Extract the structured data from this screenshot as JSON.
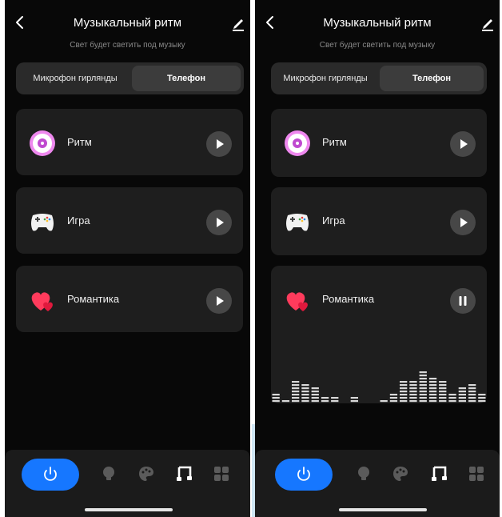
{
  "colors": {
    "accent": "#1677ff",
    "background": "#080808",
    "card": "#1e1e1e",
    "muted": "#8a8a8a"
  },
  "screens": [
    {
      "header": {
        "title": "Музыкальный ритм",
        "subtitle": "Свет будет светить под музыку",
        "back_icon": "chevron-left-icon",
        "edit_icon": "pencil-icon"
      },
      "segment": {
        "options": [
          "Микрофон гирлянды",
          "Телефон"
        ],
        "selected": "Телефон"
      },
      "cards": [
        {
          "label": "Ритм",
          "icon": "disc-icon",
          "state": "play-icon"
        },
        {
          "label": "Игра",
          "icon": "gamepad-icon",
          "state": "play-icon"
        },
        {
          "label": "Романтика",
          "icon": "hearts-icon",
          "state": "play-icon"
        }
      ],
      "tabbar": {
        "items": [
          "power-icon",
          "bulb-icon",
          "palette-icon",
          "music-icon",
          "grid-icon"
        ],
        "active": "music-icon"
      }
    },
    {
      "header": {
        "title": "Музыкальный ритм",
        "subtitle": "Свет будет светить под музыку",
        "back_icon": "chevron-left-icon",
        "edit_icon": "pencil-icon"
      },
      "segment": {
        "options": [
          "Микрофон гирлянды",
          "Телефон"
        ],
        "selected": "Телефон"
      },
      "cards": [
        {
          "label": "Ритм",
          "icon": "disc-icon",
          "state": "play-icon"
        },
        {
          "label": "Игра",
          "icon": "gamepad-icon",
          "state": "play-icon"
        },
        {
          "label": "Романтика",
          "icon": "hearts-icon",
          "state": "pause-icon",
          "equalizer_levels": [
            3,
            1,
            7,
            6,
            5,
            2,
            2,
            0,
            2,
            0,
            0,
            1,
            3,
            7,
            7,
            10,
            8,
            7,
            3,
            5,
            6,
            3
          ]
        }
      ],
      "tabbar": {
        "items": [
          "power-icon",
          "bulb-icon",
          "palette-icon",
          "music-icon",
          "grid-icon"
        ],
        "active": "music-icon"
      }
    }
  ]
}
